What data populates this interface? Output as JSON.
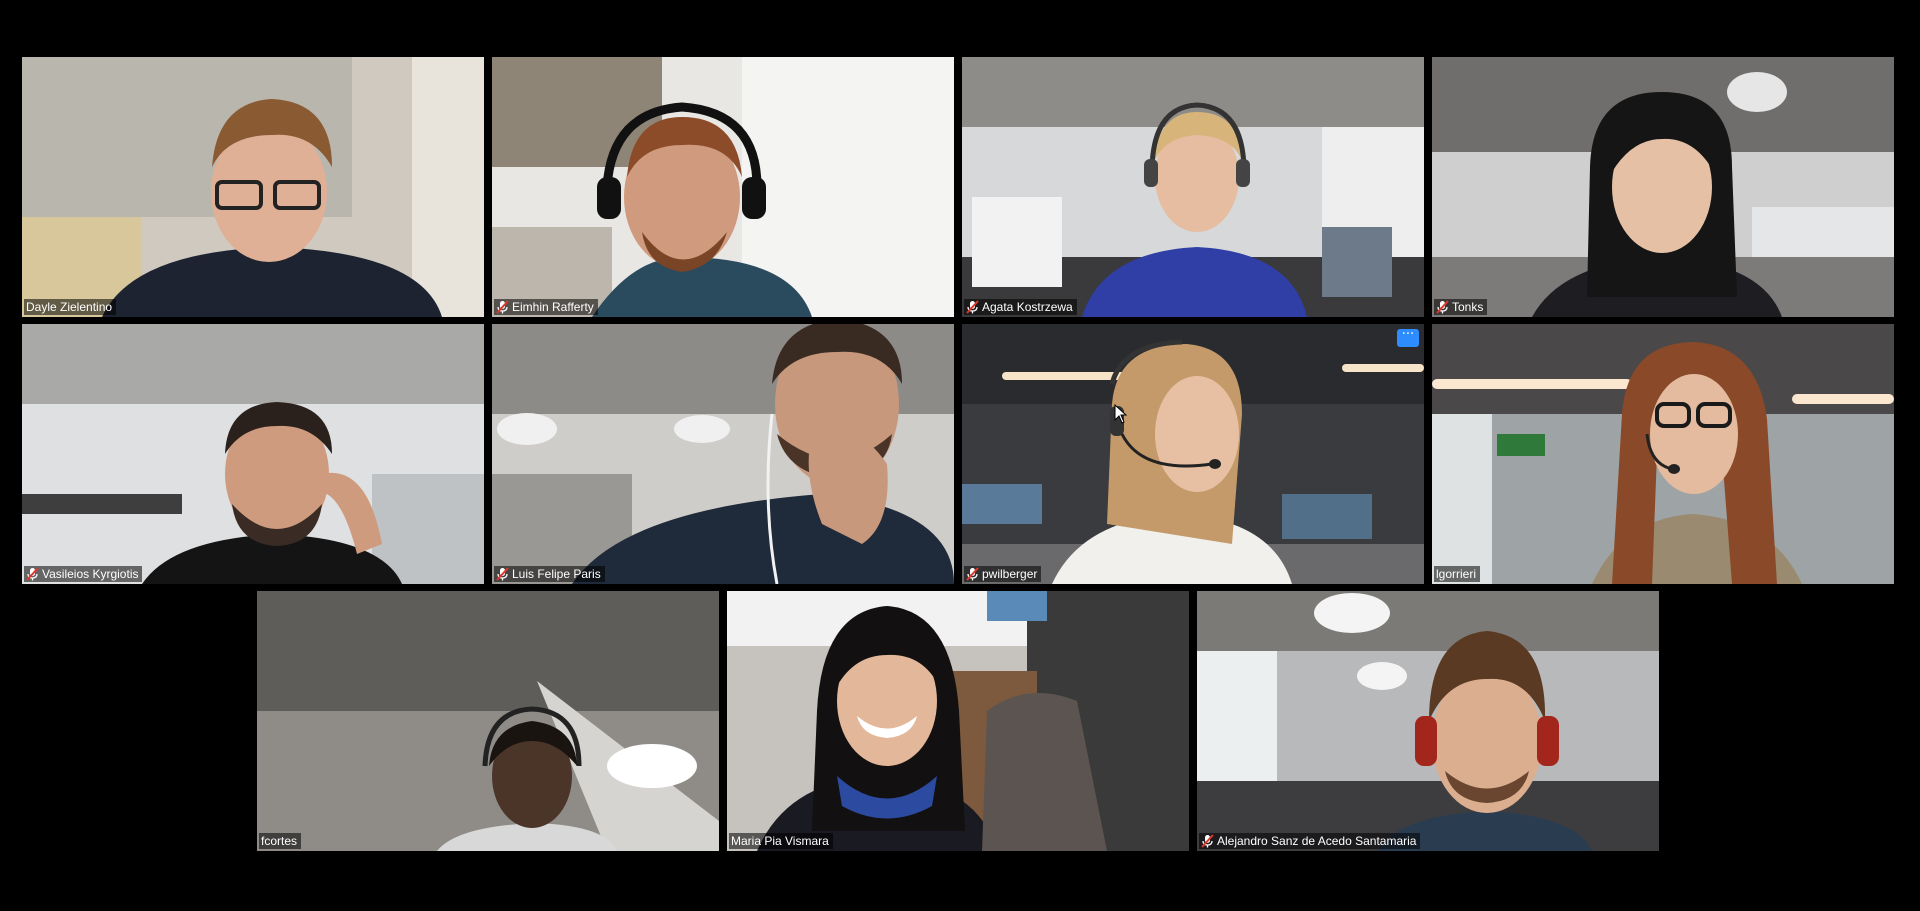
{
  "meeting": {
    "view": "gallery",
    "active_speaker_color": "#c9e265",
    "participants": [
      {
        "name": "Dayle Zielentino",
        "muted": false,
        "active": false
      },
      {
        "name": "Eimhin Rafferty",
        "muted": true,
        "active": false
      },
      {
        "name": "Agata Kostrzewa",
        "muted": true,
        "active": true
      },
      {
        "name": "Tonks",
        "muted": true,
        "active": false
      },
      {
        "name": "Vasileios Kyrgiotis",
        "muted": true,
        "active": false
      },
      {
        "name": "Luis Felipe Paris",
        "muted": true,
        "active": false
      },
      {
        "name": "pwilberger",
        "muted": true,
        "active": false,
        "menu_icon": "more-horizontal-icon",
        "menu_label": "···"
      },
      {
        "name": "lgorrieri",
        "muted": false,
        "active": false
      },
      {
        "name": "fcortes",
        "muted": false,
        "active": false
      },
      {
        "name": "Maria Pia Vismara",
        "muted": false,
        "active": false
      },
      {
        "name": "Alejandro Sanz de Acedo Santamaria",
        "muted": true,
        "active": false
      }
    ]
  }
}
